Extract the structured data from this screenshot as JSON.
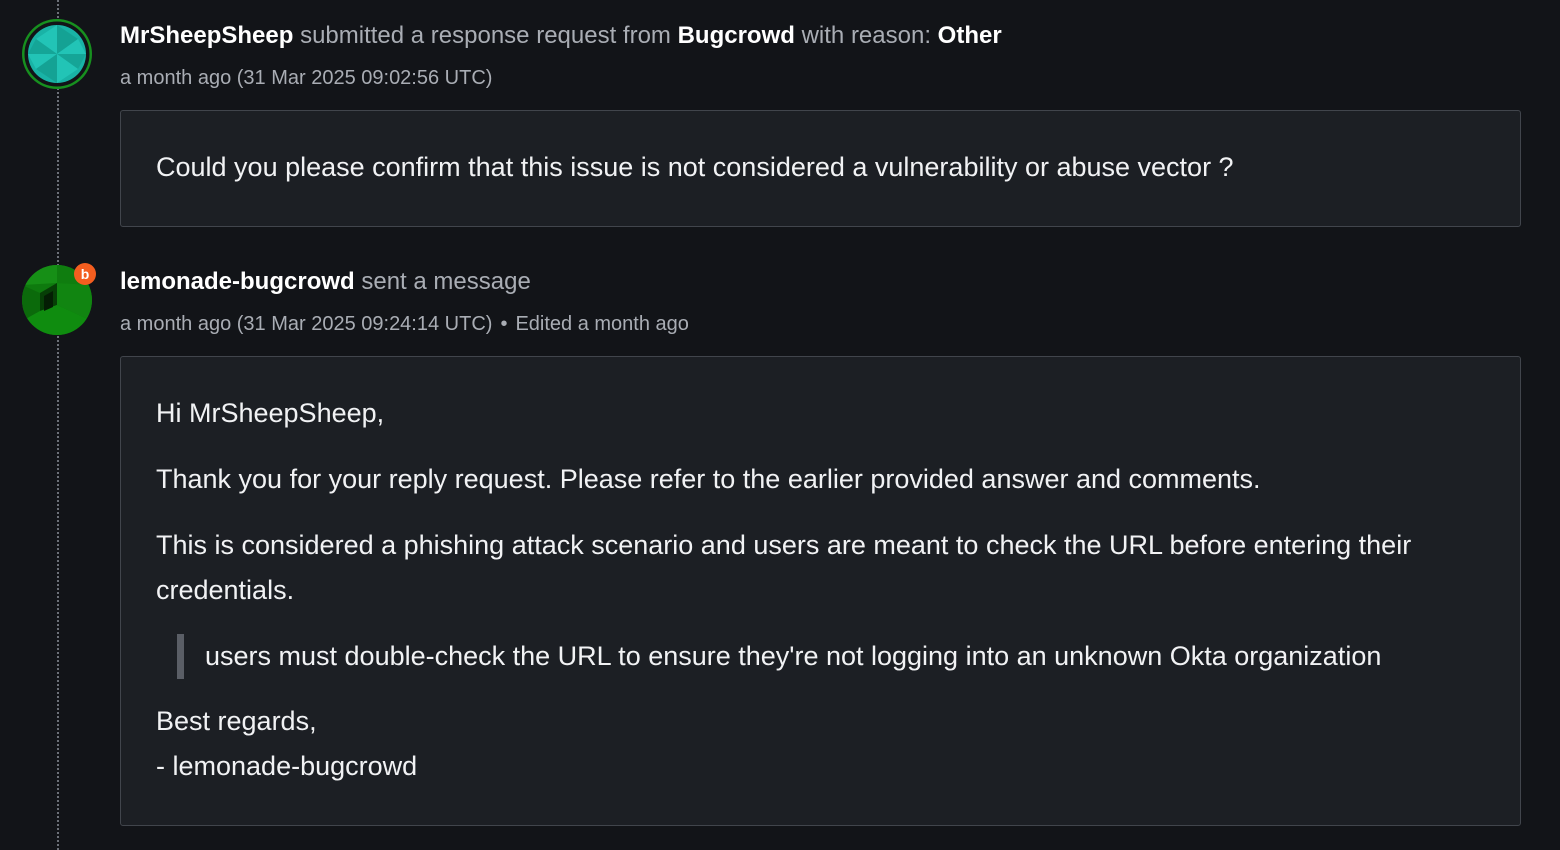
{
  "entries": [
    {
      "user": "MrSheepSheep",
      "action_part1": "submitted a response request from",
      "org": "Bugcrowd",
      "action_part2": "with reason:",
      "reason": "Other",
      "timestamp": "a month ago (31 Mar 2025 09:02:56 UTC)",
      "message": "Could you please confirm that this issue is not considered a vulnerability or abuse vector ?"
    },
    {
      "user": "lemonade-bugcrowd",
      "action": "sent a message",
      "badge": "b",
      "timestamp": "a month ago (31 Mar 2025 09:24:14 UTC)",
      "separator": "•",
      "edited": "Edited a month ago",
      "greeting": "Hi MrSheepSheep,",
      "paragraph1": "Thank you for your reply request. Please refer to the earlier provided answer and comments.",
      "paragraph2": "This is considered a phishing attack scenario and users are meant to check the URL before entering their credentials.",
      "quote": "users must double-check the URL to ensure they're not logging into an unknown Okta organization",
      "signoff": "Best regards,",
      "signature": "- lemonade-bugcrowd"
    }
  ],
  "colors": {
    "background": "#121418",
    "box_background": "#1c1f24",
    "box_border": "#41454c",
    "muted_text": "#a9adb4",
    "badge": "#f45e1f",
    "avatar_green": "#1a8a1a",
    "avatar_teal": "#19b3a6"
  }
}
